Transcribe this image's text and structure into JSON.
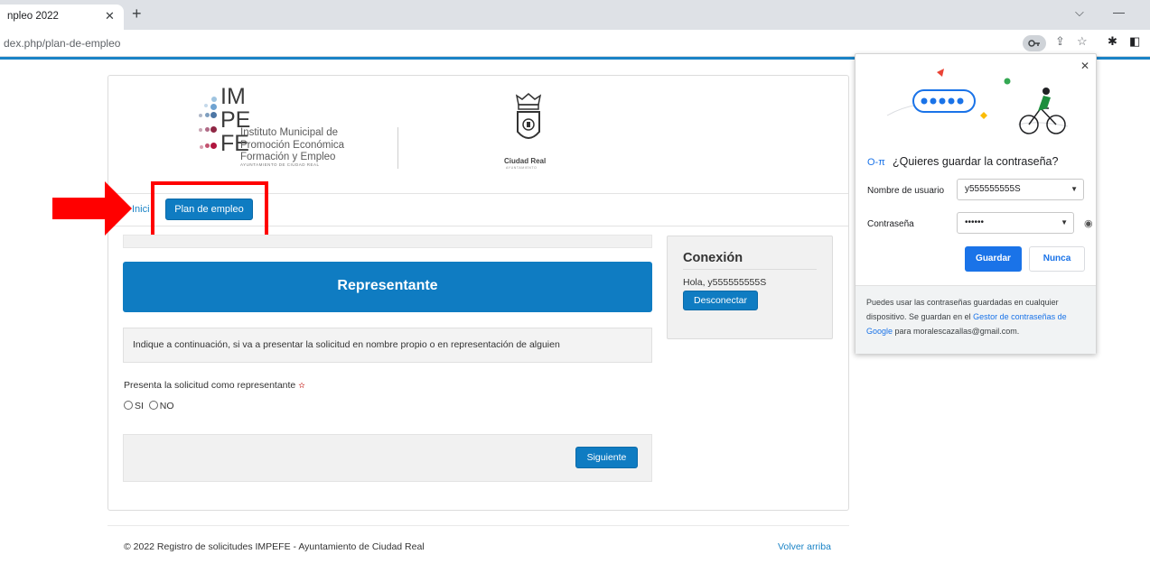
{
  "browser": {
    "tab_title": "npleo 2022",
    "url": "dex.php/plan-de-empleo"
  },
  "logo": {
    "letters_1": "IM",
    "letters_2": "PE",
    "letters_3": "FE",
    "line1": "Instituto Municipal de",
    "line2": "Promoción Económica",
    "line3": "Formación y Empleo",
    "line4": "AYUNTAMIENTO DE CIUDAD REAL",
    "city_name": "Ciudad Real",
    "city_sub": "AYUNTAMIENTO"
  },
  "nav": {
    "inicio": "Inici",
    "plan_button": "Plan de empleo"
  },
  "main": {
    "banner": "Representante",
    "note": "Indique a continuación, si va a presentar la solicitud en nombre propio o en representación de alguien",
    "question": "Presenta la solicitud como representante",
    "required_mark": "✫",
    "option_si": "SI",
    "option_no": "NO",
    "next_button": "Siguiente"
  },
  "connection": {
    "title": "Conexión",
    "greeting": "Hola, y555555555S",
    "logout_button": "Desconectar"
  },
  "footer": {
    "copyright": "© 2022 Registro de solicitudes IMPEFE - Ayuntamiento de Ciudad Real",
    "back_to_top": "Volver arriba"
  },
  "password_popup": {
    "title": "¿Quieres guardar la contraseña?",
    "username_label": "Nombre de usuario",
    "username_value": "y555555555S",
    "password_label": "Contraseña",
    "password_value": "••••••",
    "save_button": "Guardar",
    "never_button": "Nunca",
    "footer_part1": "Puedes usar las contraseñas guardadas en cualquier dispositivo. Se guardan en el ",
    "footer_link": "Gestor de contraseñas de Google",
    "footer_part2": " para moralescazallas@gmail.com."
  },
  "colors": {
    "accent": "#0f7cc2",
    "highlight": "#ff0000",
    "google_blue": "#1a73e8"
  }
}
